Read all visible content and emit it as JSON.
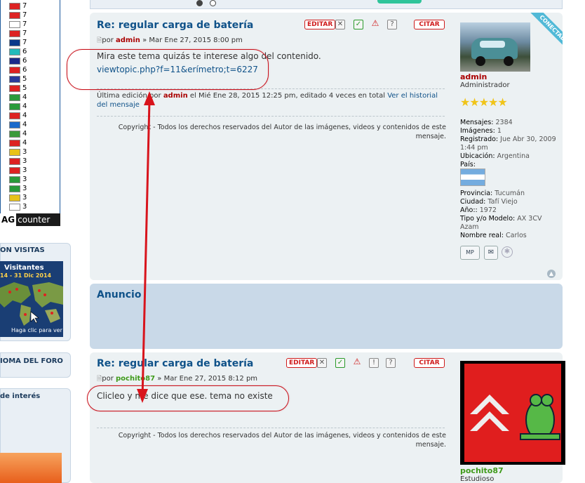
{
  "sidebar": {
    "flag_counts": [
      "7",
      "7",
      "7",
      "7",
      "7",
      "6",
      "6",
      "6",
      "5",
      "5",
      "4",
      "4",
      "4",
      "4",
      "4",
      "4",
      "3",
      "3",
      "3",
      "3",
      "3",
      "3",
      "3"
    ],
    "flag_colors": [
      "#d22",
      "#d22",
      "#fff",
      "#d22",
      "#0a3a8a",
      "#2bb",
      "#1a2a8a",
      "#d22",
      "#2a3a9a",
      "#d22",
      "#2a9a3a",
      "#2a9a3a",
      "#d22",
      "#1a6acb",
      "#3a9a3a",
      "#d22",
      "#e8c21a",
      "#d22",
      "#d22",
      "#2a9a3a",
      "#2a9a3a",
      "#e8c21a",
      "#fff"
    ],
    "flag_counter": [
      "AG",
      "counter"
    ],
    "visits_title": "ON VISITAS",
    "map_title": "Visitantes",
    "map_dates": "14 - 31 Dic 2014",
    "map_link": "Haga clic para ver",
    "idioma_title": "IOMA DEL FORO",
    "interes_title": "de interés"
  },
  "post1": {
    "title": "Re: regular carga de batería",
    "meta_por": "por",
    "author": "admin",
    "date": "» Mar Ene 27, 2015 8:00 pm",
    "text": "Mira este tema quizás te interese algo del contenido.",
    "link": "viewtopic.php?f=11&erímetro;t=6227",
    "edit_prefix": "Última edición por",
    "edit_author": "admin",
    "edit_suffix": "el Mié Ene 28, 2015 12:25 pm, editado 4 veces en total",
    "edit_history": "Ver el historial del mensaje",
    "copyright": "Copyright - Todos los derechos reservados del Autor de las imágenes, videos y contenidos de este mensaje.",
    "buttons": {
      "edit": "EDITAR",
      "quote": "CITAR"
    }
  },
  "profile1": {
    "online": "CONECTADO",
    "name": "admin",
    "rank": "Administrador",
    "stars": "★★★★★",
    "lines": [
      {
        "label": "Mensajes:",
        "value": "2384"
      },
      {
        "label": "Imágenes:",
        "value": "1"
      },
      {
        "label": "Registrado:",
        "value": "Jue Abr 30, 2009 1:44 pm"
      },
      {
        "label": "Ubicación:",
        "value": "Argentina"
      },
      {
        "label": "País:",
        "value": ""
      }
    ],
    "lines2": [
      {
        "label": "Provincia:",
        "value": "Tucumán"
      },
      {
        "label": "Ciudad:",
        "value": "Tafí Viejo"
      },
      {
        "label": "Año::",
        "value": "1972"
      },
      {
        "label": "Tipo y/o Modelo:",
        "value": "AX 3CV Azam"
      },
      {
        "label": "Nombre real:",
        "value": "Carlos"
      }
    ],
    "pm_label": "MP"
  },
  "anuncio": {
    "title": "Anuncio"
  },
  "post2": {
    "title": "Re: regular carga de batería",
    "meta_por": "por",
    "author": "pochito87",
    "date": "» Mar Ene 27, 2015 8:12 pm",
    "text": "Clicleo y me dice que ese. tema no existe",
    "copyright": "Copyright - Todos los derechos reservados del Autor de las imágenes, videos y contenidos de este mensaje.",
    "buttons": {
      "edit": "EDITAR",
      "quote": "CITAR"
    }
  },
  "profile2": {
    "name": "pochito87",
    "rank": "Estudioso"
  },
  "colors": {
    "annotation": "#c8101a",
    "title_blue": "#105289",
    "admin_red": "#aa0000",
    "user_green": "#3e9a19"
  }
}
